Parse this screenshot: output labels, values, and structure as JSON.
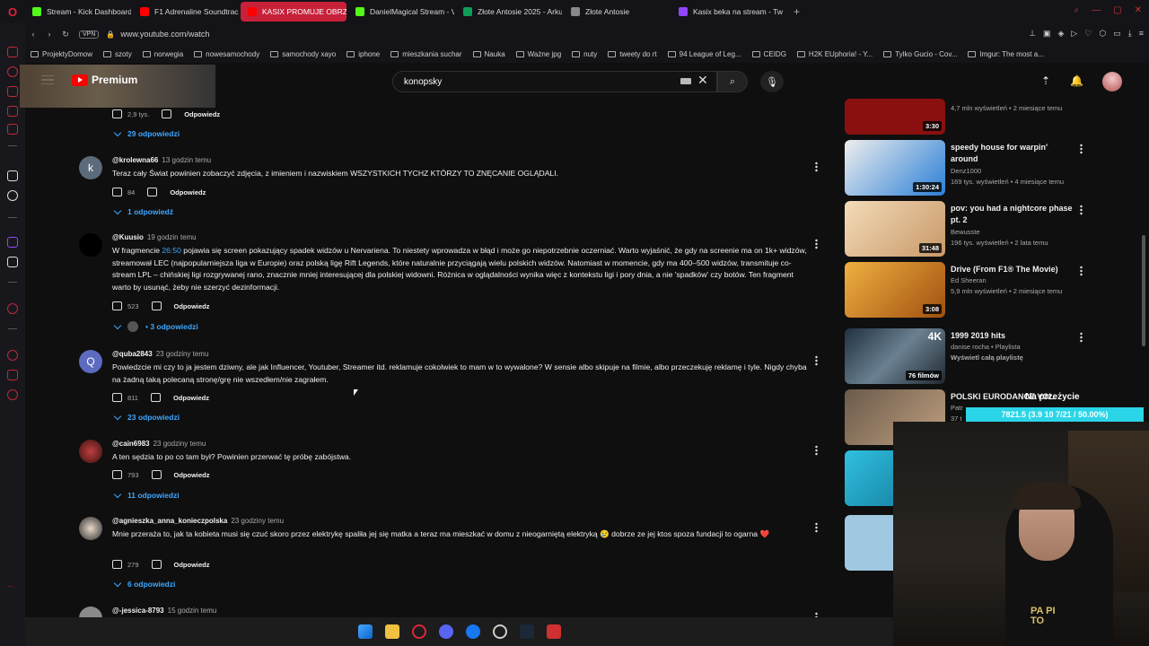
{
  "browser": {
    "tabs": [
      {
        "label": "Stream - Kick Dashboard",
        "color": "#53fc18"
      },
      {
        "label": "F1 Adrenaline Soundtrack",
        "color": "#ff0000"
      },
      {
        "label": "KASIX PROMUJE OBRZY",
        "color": "#ff0000"
      },
      {
        "label": "DanielMagical Stream - V",
        "color": "#53fc18"
      },
      {
        "label": "Złote Antosie 2025 - Arku",
        "color": "#0f9d58"
      },
      {
        "label": "Złote Antosie",
        "color": "#888888"
      },
      {
        "label": "Kasix beka na stream - Tw",
        "color": "#9146ff"
      }
    ],
    "vpn": "VPN",
    "url": "www.youtube.com/watch",
    "bookmarks": [
      "ProjektyDomow",
      "szoty",
      "norwegia",
      "nowesamochody",
      "samochody xayo",
      "iphone",
      "mieszkania suchar",
      "Nauka",
      "Ważne jpg",
      "nuty",
      "tweety do rt",
      "94 League of Leg...",
      "CEIDG",
      "H2K EUphoria! - Y...",
      "Tylko Gucio - Cov...",
      "Imgur: The most a..."
    ]
  },
  "youtube": {
    "logo": "Premium",
    "search_value": "konopsky"
  },
  "comments": [
    {
      "likes": "2,9 tys.",
      "reply_label": "Odpowiedz",
      "replies": "29 odpowiedzi"
    },
    {
      "avatar_letter": "k",
      "avatar_color": "#5c6b7a",
      "author": "@krolewna66",
      "time": "13 godzin temu",
      "text": "Teraz cały Świat powinien zobaczyć zdjęcia, z imieniem i nazwiskiem WSZYSTKICH TYCHZ KTÓRZY TO ZNĘCANIE OGLĄDALI.",
      "likes": "84",
      "reply_label": "Odpowiedz",
      "replies": "1 odpowiedź"
    },
    {
      "avatar_color": "#000000",
      "author": "@Kuusio",
      "time": "19 godzin temu",
      "text_pre": "W fragmencie ",
      "timestamp": "26:50",
      "text": " pojawia się screen pokazujący spadek widzów u Nervariena. To niestety wprowadza w błąd i może go niepotrzebnie oczerniać. Warto wyjaśnić, że gdy na screenie ma on 1k+ widzów, streamował LEC (najpopularniejsza liga w Europie) oraz polską ligę Rift Legends, które naturalnie przyciągają wielu polskich widzów. Natomiast w momencie, gdy ma 400–500 widzów, transmituje co-stream LPL – chińskiej ligi rozgrywanej rano, znacznie mniej interesującej dla polskiej widowni. Różnica w oglądalności wynika więc z kontekstu ligi i pory dnia, a nie 'spadków' czy botów. Ten fragment warto by usunąć, żeby nie szerzyć dezinformacji.",
      "likes": "523",
      "reply_label": "Odpowiedz",
      "replies": "• 3 odpowiedzi"
    },
    {
      "avatar_letter": "Q",
      "avatar_color": "#5c6bc0",
      "author": "@quba2843",
      "time": "23 godziny temu",
      "text": "Powiedzcie mi czy to ja jestem dziwny, ale jak Influencer, Youtuber, Streamer itd. reklamuje cokolwiek to mam w to wywalone? W sensie albo skipuje na filmie, albo przeczekuję reklamę i tyle. Nigdy chyba na żadną taką polecaną stronę/grę nie wszedłem/nie zagrałem.",
      "likes": "811",
      "reply_label": "Odpowiedz",
      "replies": "23 odpowiedzi"
    },
    {
      "avatar_color": "#7a2a2a",
      "author": "@cain6983",
      "time": "23 godziny temu",
      "text": "A ten sędzia to po co tam był? Powinien przerwać tę próbę zabójstwa.",
      "likes": "793",
      "reply_label": "Odpowiedz",
      "replies": "11 odpowiedzi"
    },
    {
      "avatar_color": "#3a3a3a",
      "author": "@agnieszka_anna_konieczpolska",
      "time": "23 godziny temu",
      "text": "Mnie przeraża to, jak ta kobieta musi się czuć skoro przez elektrykę spaliła jej się matka a teraz ma mieszkać w domu z nieogarniętą elektryką 😢 dobrze ze jej ktos spoza fundacji to ogarna ❤️",
      "likes": "279",
      "reply_label": "Odpowiedz",
      "replies": "6 odpowiedzi"
    },
    {
      "avatar_color": "#8a8a8a",
      "author": "@-jessica-8793",
      "time": "15 godzin temu"
    }
  ],
  "sidebar_videos": [
    {
      "duration": "3:30",
      "meta2": "4,7 mln wyświetleń • 2 miesiące temu",
      "thumb": "#8a1010"
    },
    {
      "title": "speedy house for warpin' around",
      "channel": "Denz1000",
      "meta2": "169 tys. wyświetleń • 4 miesiące temu",
      "duration": "1:30:24",
      "thumb": "#2a7fd6"
    },
    {
      "title": "pov: you had a nightcore phase pt. 2",
      "channel": "Bewusste",
      "meta2": "196 tys. wyświetleń • 2 lata temu",
      "duration": "31:48",
      "thumb": "#e8c49a"
    },
    {
      "title": "Drive (From F1® The Movie)",
      "channel": "Ed Sheeran",
      "meta2": "5,9 mln wyświetleń • 2 miesiące temu",
      "duration": "3:08",
      "thumb": "#d89020"
    },
    {
      "title": "1999 2019 hits",
      "channel": "danise rocha • Playlista",
      "meta2": "Wyświetl całą playlistę",
      "duration": "76 filmów",
      "badge": "4K",
      "thumb": "#3a4a5a"
    },
    {
      "title": "POLSKI EURODANCE VOL.",
      "channel": "Patr",
      "meta2": "37 t",
      "thumb": "#6a5a4a"
    },
    {
      "thumb": "#20a0c0"
    },
    {
      "thumb": "#a0c8e0"
    }
  ],
  "overlay": {
    "title": "Na przeżycie",
    "bar": "7821.5 (3.9 10 7/21 / 50.00%)"
  },
  "webcam": {
    "shirt": "PA PI TO"
  }
}
